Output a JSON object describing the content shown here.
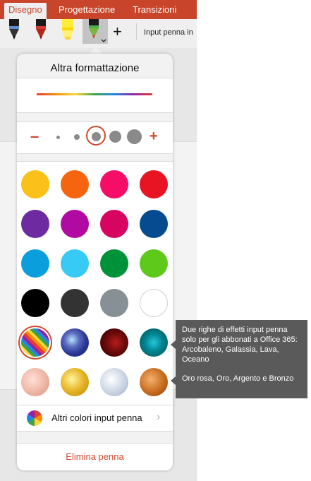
{
  "ribbon": {
    "tabs": [
      {
        "label": "Disegno",
        "active": true
      },
      {
        "label": "Progettazione",
        "active": false
      },
      {
        "label": "Transizioni",
        "active": false
      }
    ],
    "add_tool": "+",
    "input_pen_label": "Input penna in"
  },
  "popover": {
    "title": "Altra formattazione",
    "size": {
      "minus": "–",
      "plus": "+"
    },
    "more_colors_label": "Altri colori input penna",
    "delete_label": "Elimina penna"
  },
  "colors": {
    "accent": "#d04a2a",
    "tab_bar": "#c8442a",
    "row1": [
      "#fcc01a",
      "#f5650f",
      "#f50d67",
      "#e81323"
    ],
    "row2": [
      "#6e2aa0",
      "#b10aa3",
      "#d7055f",
      "#054b8f"
    ],
    "row3": [
      "#0a9fdc",
      "#36caf5",
      "#009239",
      "#5ec91b"
    ],
    "row4": [
      "#000000",
      "#333333",
      "#879094",
      "#ffffff"
    ],
    "effects_row1": [
      "rainbow",
      "galaxy",
      "lava",
      "ocean"
    ],
    "effects_row2": [
      "rose-gold",
      "gold",
      "silver",
      "bronze"
    ]
  },
  "callout": {
    "text_1": "Due righe di effetti input penna solo per gli abbonati a Office 365: Arcobaleno, Galassia, Lava, Oceano",
    "text_2": "Oro rosa, Oro, Argento e Bronzo"
  }
}
